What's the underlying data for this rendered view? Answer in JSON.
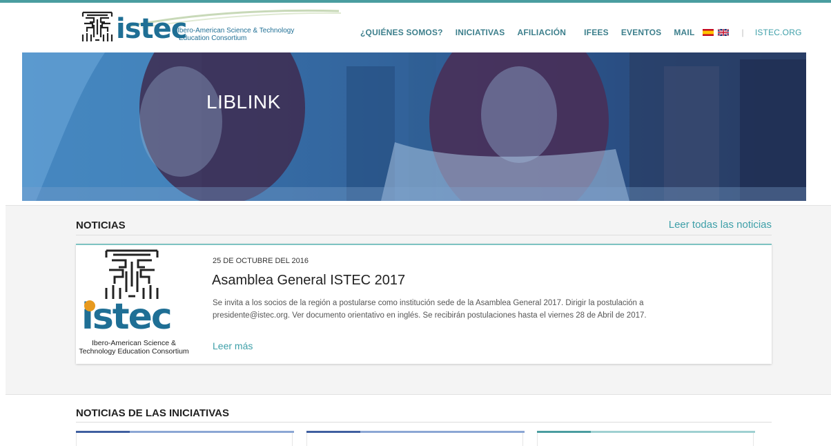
{
  "header": {
    "logo": {
      "word": "istec",
      "tagline_line1": "Ibero-American Science & Technology",
      "tagline_line2": "Education Consortium"
    },
    "nav": [
      {
        "label": "¿QUIÉNES SOMOS?"
      },
      {
        "label": "INICIATIVAS"
      },
      {
        "label": "AFILIACIÓN"
      },
      {
        "label": "IFEES"
      },
      {
        "label": "EVENTOS"
      },
      {
        "label": "MAIL"
      }
    ],
    "languages": [
      {
        "icon": "spain-flag-icon"
      },
      {
        "icon": "uk-flag-icon"
      }
    ],
    "external_link": "ISTEC.ORG"
  },
  "hero": {
    "title": "LIBLINK"
  },
  "news": {
    "title": "NOTICIAS",
    "all_link": "Leer todas las noticias",
    "items": [
      {
        "date": "25 DE OCTUBRE DEL 2016",
        "title": "Asamblea General ISTEC 2017",
        "body": "Se invita a los socios de la región a postularse como institución sede de la Asamblea General 2017. Dirigir la postulación a presidente@istec.org. Ver documento orientativo en inglés. Se recibirán postulaciones hasta el viernes 28 de Abril de 2017.",
        "more": "Leer más",
        "image": {
          "word": "istec",
          "caption_line1": "Ibero-American Science &",
          "caption_line2": "Technology Education Consortium"
        }
      }
    ]
  },
  "initiatives": {
    "title": "NOTICIAS DE LAS INICIATIVAS",
    "cards": [
      {
        "accent": "#3f5fa0",
        "light": "#8ba6d4"
      },
      {
        "accent": "#3f5fa0",
        "light": "#8ba6d4"
      },
      {
        "accent": "#4a9da0",
        "light": "#9fd0d1"
      }
    ]
  },
  "colors": {
    "brand_blue": "#1f6f95",
    "brand_teal": "#3d9fa8",
    "brand_orange": "#e79a1f"
  }
}
